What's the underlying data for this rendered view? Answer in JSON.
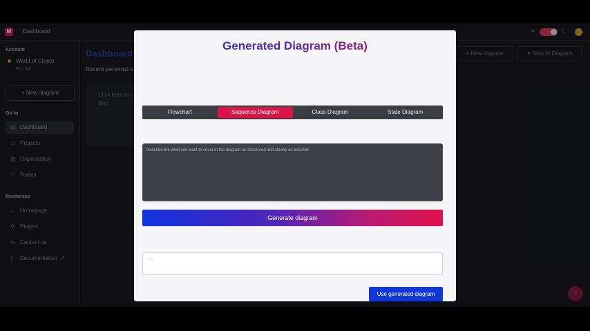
{
  "topbar": {
    "crumb": "Dashboard",
    "theme_sun": "☀",
    "theme_moon": "☾"
  },
  "sidebar": {
    "account_heading": "Account",
    "account_name": "World of Crypto",
    "account_tier": "Pro tier",
    "new_diagram": "New diagram",
    "goto_heading": "Go to",
    "goto_items": [
      {
        "label": "Dashboard",
        "icon": "dashboard-icon"
      },
      {
        "label": "Projects",
        "icon": "folder-icon"
      },
      {
        "label": "Organization",
        "icon": "building-icon"
      },
      {
        "label": "Teams",
        "icon": "users-icon"
      }
    ],
    "resources_heading": "Resources",
    "resource_items": [
      {
        "label": "Homepage",
        "icon": "home-icon"
      },
      {
        "label": "Plugins",
        "icon": "plug-icon"
      },
      {
        "label": "Contact us",
        "icon": "mail-icon"
      },
      {
        "label": "Documentation",
        "icon": "book-icon"
      }
    ]
  },
  "main": {
    "title": "Dashboard",
    "recent_label": "Recent personal a",
    "recent_card_text": "Click here to c diag",
    "new_diagram_btn": "New diagram",
    "new_ai_btn": "New AI Diagram"
  },
  "modal": {
    "title": "Generated Diagram (Beta)",
    "tabs": [
      "Flowchart",
      "Sequence Diagram",
      "Class Diagram",
      "State Diagram"
    ],
    "active_tab": "Sequence Diagram",
    "prompt_placeholder": "Describe the what you want to cover in the diagram as structured and clearly as possible",
    "generate_label": "Generate diagram",
    "result_placeholder": "Info",
    "use_label": "Use generated diagram"
  },
  "colors": {
    "accent_red": "#dc1549",
    "accent_blue": "#1137d8",
    "modal_bg": "#f5f5f7"
  }
}
